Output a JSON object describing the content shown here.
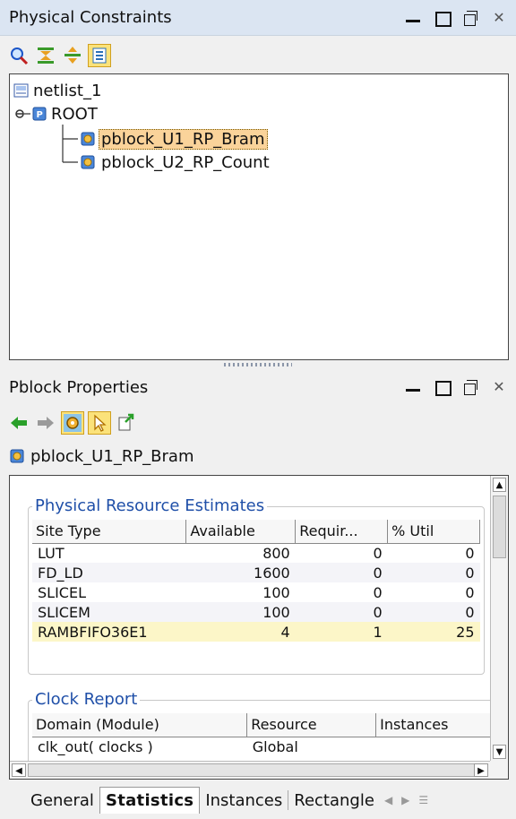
{
  "constraints_panel": {
    "title": "Physical Constraints",
    "tree": {
      "netlist": "netlist_1",
      "root": "ROOT",
      "pblocks": [
        "pblock_U1_RP_Bram",
        "pblock_U2_RP_Count"
      ]
    }
  },
  "properties_panel": {
    "title": "Pblock Properties",
    "selected": "pblock_U1_RP_Bram",
    "resource_group": {
      "title": "Physical Resource Estimates",
      "headers": [
        "Site Type",
        "Available",
        "Requir...",
        "% Util"
      ],
      "rows": [
        [
          "LUT",
          "800",
          "0",
          "0"
        ],
        [
          "FD_LD",
          "1600",
          "0",
          "0"
        ],
        [
          "SLICEL",
          "100",
          "0",
          "0"
        ],
        [
          "SLICEM",
          "100",
          "0",
          "0"
        ],
        [
          "RAMBFIFO36E1",
          "4",
          "1",
          "25"
        ]
      ]
    },
    "clock_group": {
      "title": "Clock Report",
      "headers": [
        "Domain (Module)",
        "Resource",
        "Instances"
      ],
      "rows": [
        [
          "clk_out( clocks )",
          "Global",
          ""
        ]
      ]
    },
    "tabs": [
      "General",
      "Statistics",
      "Instances",
      "Rectangle"
    ]
  },
  "colors": {
    "title_bar_bg": "#dbe5f2",
    "selection": "#fad39a",
    "group_title": "#1f4fa8",
    "highlight_row": "#fcf6c8"
  }
}
